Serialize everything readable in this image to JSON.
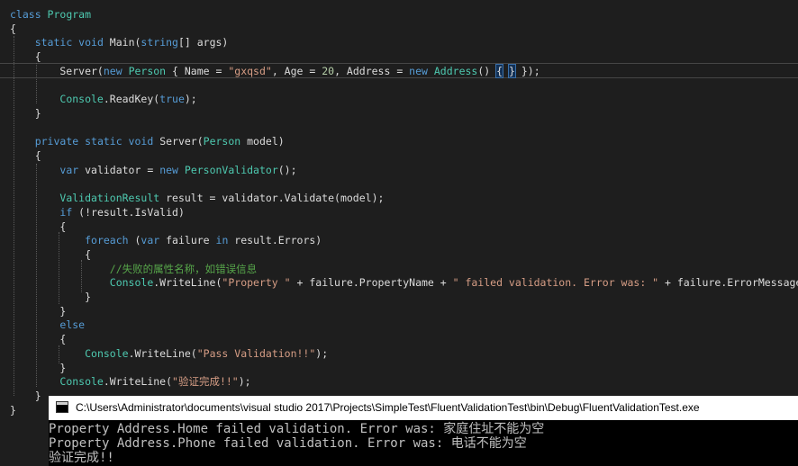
{
  "editor": {
    "lines": [
      [
        {
          "t": "class ",
          "c": "kw"
        },
        {
          "t": "Program",
          "c": "ty"
        }
      ],
      [
        {
          "t": "{",
          "c": ""
        }
      ],
      [
        {
          "t": "    ",
          "c": ""
        },
        {
          "t": "static void ",
          "c": "kw"
        },
        {
          "t": "Main(",
          "c": ""
        },
        {
          "t": "string",
          "c": "kw"
        },
        {
          "t": "[] args)",
          "c": ""
        }
      ],
      [
        {
          "t": "    {",
          "c": ""
        }
      ],
      [
        {
          "t": "        Server(",
          "c": ""
        },
        {
          "t": "new ",
          "c": "kw"
        },
        {
          "t": "Person",
          "c": "ty"
        },
        {
          "t": " { Name = ",
          "c": ""
        },
        {
          "t": "\"gxqsd\"",
          "c": "st"
        },
        {
          "t": ", Age = ",
          "c": ""
        },
        {
          "t": "20",
          "c": "nu"
        },
        {
          "t": ", Address = ",
          "c": ""
        },
        {
          "t": "new ",
          "c": "kw"
        },
        {
          "t": "Address",
          "c": "ty"
        },
        {
          "t": "() ",
          "c": ""
        },
        {
          "t": "{",
          "c": "brm"
        },
        {
          "t": " ",
          "c": ""
        },
        {
          "t": "}",
          "c": "brm"
        },
        {
          "t": " });",
          "c": ""
        }
      ],
      [
        {
          "t": "",
          "c": ""
        }
      ],
      [
        {
          "t": "        ",
          "c": ""
        },
        {
          "t": "Console",
          "c": "ty"
        },
        {
          "t": ".ReadKey(",
          "c": ""
        },
        {
          "t": "true",
          "c": "kw"
        },
        {
          "t": ");",
          "c": ""
        }
      ],
      [
        {
          "t": "    }",
          "c": ""
        }
      ],
      [
        {
          "t": "",
          "c": ""
        }
      ],
      [
        {
          "t": "    ",
          "c": ""
        },
        {
          "t": "private static void ",
          "c": "kw"
        },
        {
          "t": "Server(",
          "c": ""
        },
        {
          "t": "Person",
          "c": "ty"
        },
        {
          "t": " model)",
          "c": ""
        }
      ],
      [
        {
          "t": "    {",
          "c": ""
        }
      ],
      [
        {
          "t": "        ",
          "c": ""
        },
        {
          "t": "var ",
          "c": "kw"
        },
        {
          "t": "validator = ",
          "c": ""
        },
        {
          "t": "new ",
          "c": "kw"
        },
        {
          "t": "PersonValidator",
          "c": "ty"
        },
        {
          "t": "();",
          "c": ""
        }
      ],
      [
        {
          "t": "",
          "c": ""
        }
      ],
      [
        {
          "t": "        ",
          "c": ""
        },
        {
          "t": "ValidationResult",
          "c": "ty"
        },
        {
          "t": " result = validator.Validate(model);",
          "c": ""
        }
      ],
      [
        {
          "t": "        ",
          "c": ""
        },
        {
          "t": "if ",
          "c": "kw"
        },
        {
          "t": "(!result.IsValid)",
          "c": ""
        }
      ],
      [
        {
          "t": "        {",
          "c": ""
        }
      ],
      [
        {
          "t": "            ",
          "c": ""
        },
        {
          "t": "foreach ",
          "c": "kw"
        },
        {
          "t": "(",
          "c": ""
        },
        {
          "t": "var ",
          "c": "kw"
        },
        {
          "t": "failure ",
          "c": ""
        },
        {
          "t": "in ",
          "c": "kw"
        },
        {
          "t": "result.Errors)",
          "c": ""
        }
      ],
      [
        {
          "t": "            {",
          "c": ""
        }
      ],
      [
        {
          "t": "                ",
          "c": ""
        },
        {
          "t": "//失败的属性名称，如错误信息",
          "c": "cm"
        }
      ],
      [
        {
          "t": "                ",
          "c": ""
        },
        {
          "t": "Console",
          "c": "ty"
        },
        {
          "t": ".WriteLine(",
          "c": ""
        },
        {
          "t": "\"Property \"",
          "c": "st"
        },
        {
          "t": " + failure.PropertyName + ",
          "c": ""
        },
        {
          "t": "\" failed validation. Error was: \"",
          "c": "st"
        },
        {
          "t": " + failure.ErrorMessage);",
          "c": ""
        }
      ],
      [
        {
          "t": "            }",
          "c": ""
        }
      ],
      [
        {
          "t": "        }",
          "c": ""
        }
      ],
      [
        {
          "t": "        ",
          "c": ""
        },
        {
          "t": "else",
          "c": "kw"
        }
      ],
      [
        {
          "t": "        {",
          "c": ""
        }
      ],
      [
        {
          "t": "            ",
          "c": ""
        },
        {
          "t": "Console",
          "c": "ty"
        },
        {
          "t": ".WriteLine(",
          "c": ""
        },
        {
          "t": "\"Pass Validation!!\"",
          "c": "st"
        },
        {
          "t": ");",
          "c": ""
        }
      ],
      [
        {
          "t": "        }",
          "c": ""
        }
      ],
      [
        {
          "t": "        ",
          "c": ""
        },
        {
          "t": "Console",
          "c": "ty"
        },
        {
          "t": ".WriteLine(",
          "c": ""
        },
        {
          "t": "\"验证完成!!\"",
          "c": "st"
        },
        {
          "t": ");",
          "c": ""
        }
      ],
      [
        {
          "t": "    }",
          "c": ""
        }
      ],
      [
        {
          "t": "}",
          "c": ""
        }
      ]
    ]
  },
  "console": {
    "title": "C:\\Users\\Administrator\\documents\\visual studio 2017\\Projects\\SimpleTest\\FluentValidationTest\\bin\\Debug\\FluentValidationTest.exe",
    "output": [
      "Property Address.Home failed validation. Error was: 家庭住址不能为空",
      "Property Address.Phone failed validation. Error was: 电话不能为空",
      "验证完成!!"
    ]
  }
}
